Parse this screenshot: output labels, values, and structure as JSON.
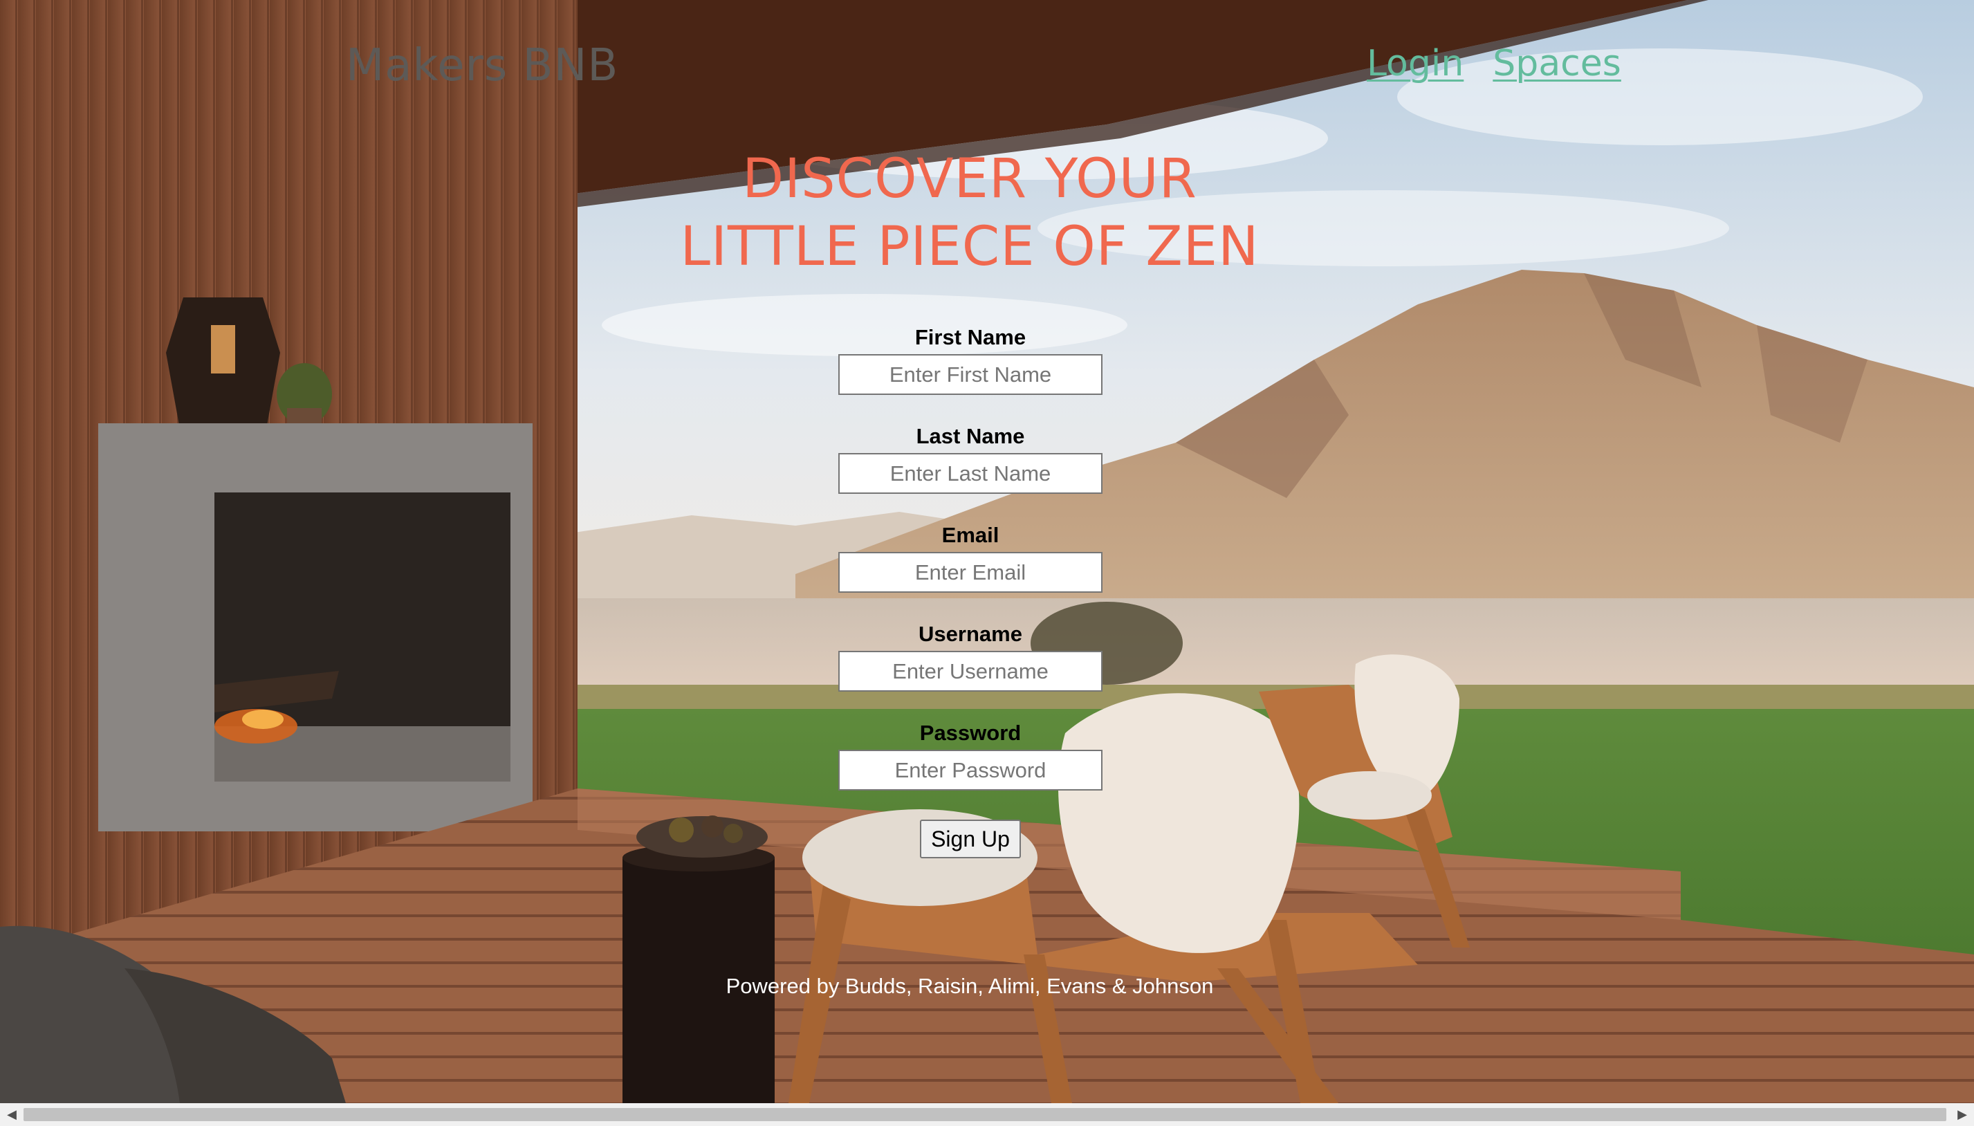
{
  "header": {
    "brand": "Makers BNB",
    "nav": {
      "login_label": "Login",
      "spaces_label": "Spaces"
    }
  },
  "hero": {
    "line1": "DISCOVER YOUR",
    "line2": "LITTLE PIECE OF ZEN"
  },
  "form": {
    "fields": [
      {
        "label": "First Name",
        "placeholder": "Enter First Name",
        "value": ""
      },
      {
        "label": "Last Name",
        "placeholder": "Enter Last Name",
        "value": ""
      },
      {
        "label": "Email",
        "placeholder": "Enter Email",
        "value": ""
      },
      {
        "label": "Username",
        "placeholder": "Enter Username",
        "value": ""
      },
      {
        "label": "Password",
        "placeholder": "Enter Password",
        "value": ""
      }
    ],
    "submit_label": "Sign Up"
  },
  "footer": {
    "credit": "Powered by Budds, Raisin, Alimi, Evans & Johnson"
  },
  "colors": {
    "brand_text": "#5d5a57",
    "nav_link": "#63bc9d",
    "hero_text": "#f0684e",
    "footer_text": "#ffffff"
  },
  "icons": {
    "scroll_left": "chevron-left-icon",
    "scroll_right": "chevron-right-icon"
  }
}
